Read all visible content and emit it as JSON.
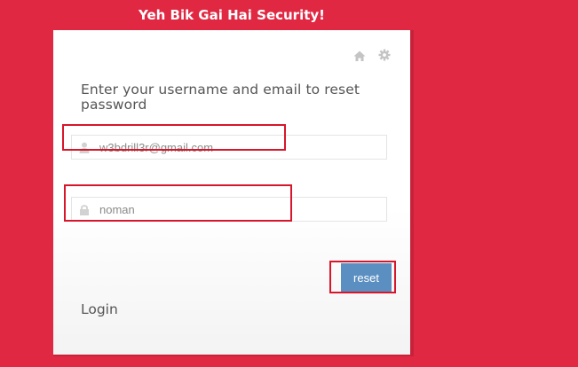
{
  "banner": {
    "title": "Yeh Bik Gai Hai Security!"
  },
  "card": {
    "icons": {
      "home": "home-icon",
      "settings": "gear-icon"
    },
    "heading": "Enter your username and email to reset password",
    "email_field": {
      "value": "w3bdrill3r@gmail.com",
      "icon": "user-icon"
    },
    "username_field": {
      "value": "noman",
      "icon": "lock-icon"
    },
    "reset_label": "reset",
    "login_label": "Login"
  },
  "colors": {
    "background": "#e02843",
    "button": "#5b8fc1",
    "highlight": "#d8162b"
  }
}
